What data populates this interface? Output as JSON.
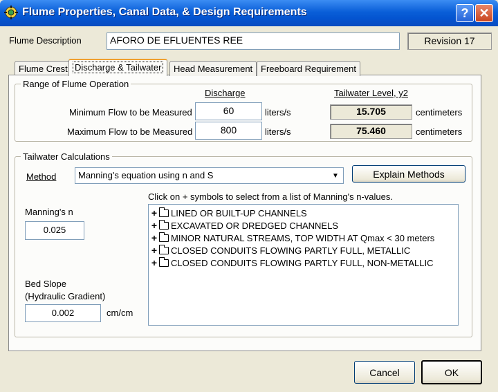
{
  "window": {
    "title": "Flume Properties, Canal Data, & Design Requirements",
    "help_glyph": "?",
    "close_glyph": "✕",
    "app_icon": "flume-gear-icon"
  },
  "header": {
    "description_label": "Flume Description",
    "description_value": "AFORO DE EFLUENTES REE",
    "revision": "Revision 17"
  },
  "tabs": [
    {
      "label": "Flume Crest",
      "active": false
    },
    {
      "label": "Discharge & Tailwater",
      "active": true
    },
    {
      "label": "Head Measurement",
      "active": false
    },
    {
      "label": "Freeboard Requirement",
      "active": false
    }
  ],
  "range": {
    "group_title": "Range of Flume Operation",
    "discharge_header": "Discharge",
    "tailwater_header": "Tailwater Level, y2",
    "min_label": "Minimum Flow to be Measured",
    "min_value": "60",
    "min_unit": "liters/s",
    "min_tailwater": "15.705",
    "min_tw_unit": "centimeters",
    "max_label": "Maximum Flow to be Measured",
    "max_value": "800",
    "max_unit": "liters/s",
    "max_tailwater": "75.460",
    "max_tw_unit": "centimeters"
  },
  "tailwater": {
    "group_title": "Tailwater Calculations",
    "method_label": "Method",
    "method_value": "Manning's equation using n and S",
    "explain_button": "Explain Methods",
    "instruction": "Click on + symbols to select from a list of Manning's n-values.",
    "manning_label": "Manning's n",
    "manning_value": "0.025",
    "slope_label_1": "Bed Slope",
    "slope_label_2": "(Hydraulic Gradient)",
    "slope_value": "0.002",
    "slope_unit": "cm/cm",
    "tree_items": [
      "LINED OR BUILT-UP CHANNELS",
      "EXCAVATED OR DREDGED CHANNELS",
      "MINOR NATURAL STREAMS, TOP WIDTH AT Qmax < 30 meters",
      "CLOSED CONDUITS FLOWING PARTLY FULL, METALLIC",
      "CLOSED CONDUITS FLOWING PARTLY FULL, NON-METALLIC"
    ]
  },
  "footer": {
    "cancel": "Cancel",
    "ok": "OK"
  }
}
